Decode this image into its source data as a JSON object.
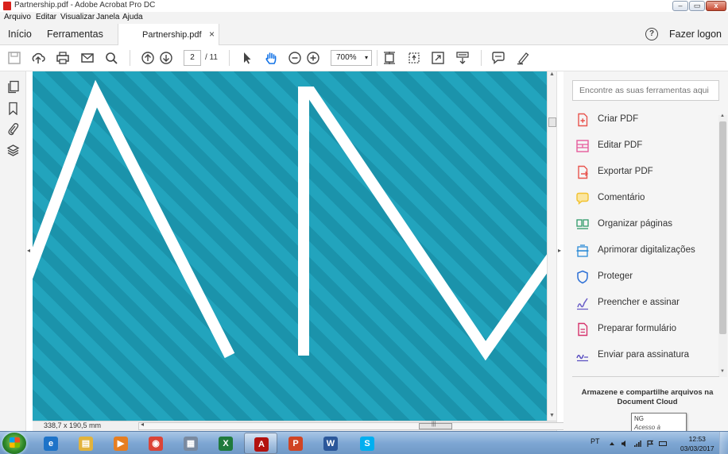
{
  "window": {
    "title": "Partnership.pdf - Adobe Acrobat Pro DC",
    "buttons": {
      "minimize": "–",
      "maximize": "▭",
      "close": "x"
    }
  },
  "menu": {
    "items": [
      "Arquivo",
      "Editar",
      "Visualizar",
      "Janela",
      "Ajuda"
    ]
  },
  "tabs": {
    "home": "Início",
    "tools": "Ferramentas",
    "document": "Partnership.pdf",
    "close_glyph": "×",
    "help_glyph": "?",
    "login": "Fazer logon"
  },
  "toolbar": {
    "icons": [
      "save-icon",
      "cloud-upload-icon",
      "print-icon",
      "email-icon",
      "search-icon",
      "page-up-icon",
      "page-down-icon",
      "select-arrow-icon",
      "hand-icon",
      "zoom-out-icon",
      "zoom-in-icon",
      "fit-page-icon",
      "rotate-icon",
      "fullscreen-icon",
      "scroll-mode-icon",
      "comment-icon",
      "highlight-pen-icon"
    ],
    "page_current": "2",
    "page_total": "/ 11",
    "zoom": "700%",
    "zoom_arrow": "▾"
  },
  "left_rail": {
    "icons": [
      "pages-icon",
      "bookmark-icon",
      "attachment-icon",
      "layers-icon"
    ]
  },
  "document": {
    "background": "#1f9db6",
    "stroke_color": "#ffffff"
  },
  "status": {
    "dimensions": "338,7 x 190,5 mm",
    "scroll_left": "◂",
    "scroll_right": "▸",
    "grip": "|||"
  },
  "collapse": {
    "left": "◂",
    "right": "▸"
  },
  "right_panel": {
    "search_placeholder": "Encontre as suas ferramentas aqui",
    "tools": [
      {
        "label": "Criar PDF",
        "icon": "create-pdf-icon",
        "color": "#e8554e"
      },
      {
        "label": "Editar PDF",
        "icon": "edit-pdf-icon",
        "color": "#e65b9c"
      },
      {
        "label": "Exportar PDF",
        "icon": "export-pdf-icon",
        "color": "#e8554e"
      },
      {
        "label": "Comentário",
        "icon": "comment-icon",
        "color": "#f2c230"
      },
      {
        "label": "Organizar páginas",
        "icon": "organize-pages-icon",
        "color": "#2f9b6a"
      },
      {
        "label": "Aprimorar digitalizações",
        "icon": "enhance-scans-icon",
        "color": "#2c8ad6"
      },
      {
        "label": "Proteger",
        "icon": "protect-shield-icon",
        "color": "#2c6fd6"
      },
      {
        "label": "Preencher e assinar",
        "icon": "fill-sign-icon",
        "color": "#6a5ec8"
      },
      {
        "label": "Preparar formulário",
        "icon": "prepare-form-icon",
        "color": "#d6336c"
      },
      {
        "label": "Enviar para assinatura",
        "icon": "send-signature-icon",
        "color": "#5a4fc0"
      }
    ],
    "cloud_text": "Armazene e compartilhe arquivos na Document Cloud",
    "scroll_up": "▲",
    "scroll_down": "▼"
  },
  "tooltip": {
    "title": "NG",
    "subtitle": "Acesso à Internet"
  },
  "taskbar": {
    "apps": [
      {
        "name": "internet-explorer-icon",
        "glyph": "e",
        "color": "#1e73c8"
      },
      {
        "name": "file-explorer-icon",
        "glyph": "▤",
        "color": "#e2b33c"
      },
      {
        "name": "media-player-icon",
        "glyph": "▶",
        "color": "#e67e22"
      },
      {
        "name": "chrome-icon",
        "glyph": "◉",
        "color": "#db4437"
      },
      {
        "name": "calculator-icon",
        "glyph": "▦",
        "color": "#7a8aa0"
      },
      {
        "name": "excel-icon",
        "glyph": "X",
        "color": "#1f7a3c"
      },
      {
        "name": "acrobat-icon",
        "glyph": "A",
        "color": "#b3120f"
      },
      {
        "name": "powerpoint-icon",
        "glyph": "P",
        "color": "#d04423"
      },
      {
        "name": "word-icon",
        "glyph": "W",
        "color": "#2b579a"
      },
      {
        "name": "skype-icon",
        "glyph": "S",
        "color": "#00aff0"
      }
    ],
    "active_app": "acrobat-icon",
    "language": "PT",
    "time": "12:53",
    "date": "03/03/2017"
  }
}
